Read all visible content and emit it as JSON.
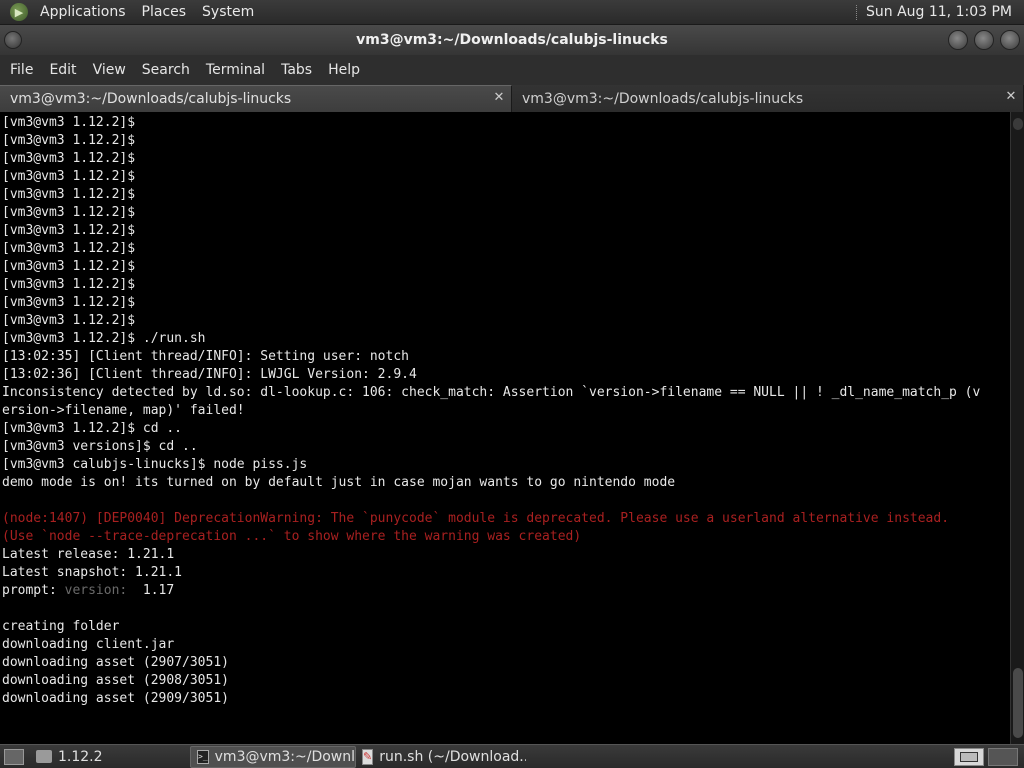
{
  "top_panel": {
    "menus": [
      "Applications",
      "Places",
      "System"
    ],
    "clock": "Sun Aug 11,  1:03 PM",
    "logo_icon": "mate-logo-icon"
  },
  "window": {
    "title": "vm3@vm3:~/Downloads/calubjs-linucks"
  },
  "menubar": {
    "items": [
      "File",
      "Edit",
      "View",
      "Search",
      "Terminal",
      "Tabs",
      "Help"
    ]
  },
  "tabs": [
    {
      "label": "vm3@vm3:~/Downloads/calubjs-linucks",
      "active": true
    },
    {
      "label": "vm3@vm3:~/Downloads/calubjs-linucks",
      "active": false
    }
  ],
  "terminal": {
    "colors": {
      "background": "#000000",
      "text": "#e8e8e8",
      "warning": "#a82020",
      "dim": "#6a6a6a"
    },
    "lines": [
      {
        "text": "[vm3@vm3 1.12.2]$"
      },
      {
        "text": "[vm3@vm3 1.12.2]$"
      },
      {
        "text": "[vm3@vm3 1.12.2]$"
      },
      {
        "text": "[vm3@vm3 1.12.2]$"
      },
      {
        "text": "[vm3@vm3 1.12.2]$"
      },
      {
        "text": "[vm3@vm3 1.12.2]$"
      },
      {
        "text": "[vm3@vm3 1.12.2]$"
      },
      {
        "text": "[vm3@vm3 1.12.2]$"
      },
      {
        "text": "[vm3@vm3 1.12.2]$"
      },
      {
        "text": "[vm3@vm3 1.12.2]$"
      },
      {
        "text": "[vm3@vm3 1.12.2]$"
      },
      {
        "text": "[vm3@vm3 1.12.2]$"
      },
      {
        "text": "[vm3@vm3 1.12.2]$ ./run.sh"
      },
      {
        "text": "[13:02:35] [Client thread/INFO]: Setting user: notch"
      },
      {
        "text": "[13:02:36] [Client thread/INFO]: LWJGL Version: 2.9.4"
      },
      {
        "text": "Inconsistency detected by ld.so: dl-lookup.c: 106: check_match: Assertion `version->filename == NULL || ! _dl_name_match_p (v"
      },
      {
        "text": "ersion->filename, map)' failed!"
      },
      {
        "text": "[vm3@vm3 1.12.2]$ cd .."
      },
      {
        "text": "[vm3@vm3 versions]$ cd .."
      },
      {
        "text": "[vm3@vm3 calubjs-linucks]$ node piss.js"
      },
      {
        "text": "demo mode is on! its turned on by default just in case mojan wants to go nintendo mode"
      },
      {
        "text": ""
      },
      {
        "text": "(node:1407) [DEP0040] DeprecationWarning: The `punycode` module is deprecated. Please use a userland alternative instead.",
        "style": "warn"
      },
      {
        "text": "(Use `node --trace-deprecation ...` to show where the warning was created)",
        "style": "warn"
      },
      {
        "text": "Latest release: 1.21.1"
      },
      {
        "text": "Latest snapshot: 1.21.1"
      },
      {
        "text": "prompt: ",
        "dim": "version:",
        "after": "  1.17"
      },
      {
        "text": ""
      },
      {
        "text": "creating folder"
      },
      {
        "text": "downloading client.jar"
      },
      {
        "text": "downloading asset (2907/3051)"
      },
      {
        "text": "downloading asset (2908/3051)"
      },
      {
        "text": "downloading asset (2909/3051)"
      }
    ]
  },
  "taskbar": {
    "items": [
      {
        "label": "1.12.2",
        "icon": "folder-icon",
        "active": false
      },
      {
        "label": "vm3@vm3:~/Downl...",
        "icon": "terminal-icon",
        "active": true
      },
      {
        "label": "run.sh (~/Download...",
        "icon": "text-editor-icon",
        "active": false
      }
    ]
  }
}
